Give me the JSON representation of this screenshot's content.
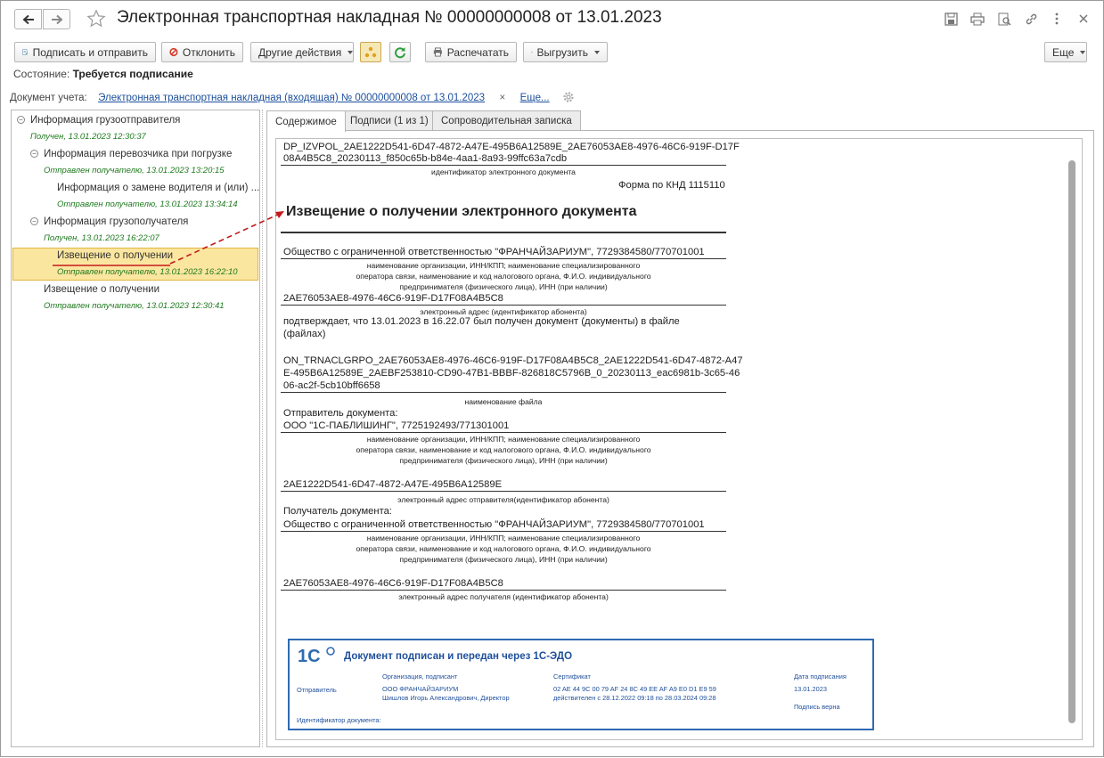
{
  "window": {
    "title": "Электронная транспортная накладная № 00000000008 от 13.01.2023",
    "icons": [
      "save-icon",
      "print-icon",
      "preview-icon",
      "link-icon",
      "more-icon",
      "close-icon"
    ]
  },
  "toolbar": {
    "sign_send": "Подписать и отправить",
    "reject": "Отклонить",
    "other_actions": "Другие действия",
    "print": "Распечатать",
    "export": "Выгрузить",
    "more": "Еще"
  },
  "state": {
    "label": "Состояние:",
    "value": "Требуется подписание"
  },
  "doc_account": {
    "label": "Документ учета:",
    "link": "Электронная транспортная накладная (входящая) № 00000000008 от 13.01.2023",
    "clear": "×",
    "more": "Еще..."
  },
  "tree": [
    {
      "title": "Информация грузоотправителя",
      "status": "Получен, 13.01.2023 12:30:37"
    },
    {
      "title": "Информация перевозчика при погрузке",
      "status": "Отправлен получателю, 13.01.2023 13:20:15"
    },
    {
      "title": "Информация о замене водителя и (или) ...",
      "status": "Отправлен получателю, 13.01.2023 13:34:14"
    },
    {
      "title": "Информация грузополучателя",
      "status": "Получен, 13.01.2023 16:22:07"
    },
    {
      "title": "Извещение о получении",
      "status": "Отправлен получателю, 13.01.2023 16:22:10"
    },
    {
      "title": "Извещение о получении",
      "status": "Отправлен получателю, 13.01.2023 12:30:41"
    }
  ],
  "tabs": [
    "Содержимое",
    "Подписи (1 из 1)",
    "Сопроводительная записка"
  ],
  "doc": {
    "id_line1": "DP_IZVPOL_2AE1222D541-6D47-4872-A47E-495B6A12589E_2AE76053AE8-4976-46C6-919F-D17F",
    "id_line2": "08A4B5C8_20230113_f850c65b-b84e-4aa1-8a93-99ffc63a7cdb",
    "id_caption": "идентификатор электронного документа",
    "form": "Форма по КНД 1115110",
    "heading": "Извещение о получении электронного документа",
    "org1": "Общество с ограниченной ответственностью \"ФРАНЧАЙЗАРИУМ\", 7729384580/770701001",
    "cap_org_1": "наименование организации, ИНН/КПП; наименование специализированного",
    "cap_org_2": "оператора связи, наименование и код налогового органа, Ф.И.О. индивидуального",
    "cap_org_3": "предпринимателя (физического лица), ИНН (при наличии)",
    "addr1": "2AE76053AE8-4976-46C6-919F-D17F08A4B5C8",
    "cap_addr1": "электронный адрес (идентификатор абонента)",
    "confirm1": "подтверждает, что 13.01.2023 в 16.22.07 был получен документ (документы) в файле",
    "confirm2": "(файлах)",
    "file1": "ON_TRNACLGRPO_2AE76053AE8-4976-46C6-919F-D17F08A4B5C8_2AE1222D541-6D47-4872-A47",
    "file2": "E-495B6A12589E_2AEBF253810-CD90-47B1-BBBF-826818C5796B_0_20230113_eac6981b-3c65-46",
    "file3": "06-ac2f-5cb10bff6658",
    "cap_file": "наименование файла",
    "sender_label": "Отправитель документа:",
    "sender": "ООО \"1С-ПАБЛИШИНГ\", 7725192493/771301001",
    "addr_sender": "2AE1222D541-6D47-4872-A47E-495B6A12589E",
    "cap_addr_sender": "электронный адрес отправителя(идентификатор абонента)",
    "recipient_label": "Получатель документа:",
    "recipient": "Общество с ограниченной ответственностью \"ФРАНЧАЙЗАРИУМ\", 7729384580/770701001",
    "addr_recipient": "2AE76053AE8-4976-46C6-919F-D17F08A4B5C8",
    "cap_addr_recipient": "электронный адрес получателя (идентификатор абонента)"
  },
  "stamp": {
    "logo": "1С",
    "title": "Документ подписан и передан через 1С-ЭДО",
    "col_org": "Организация, подписант",
    "col_cert": "Сертификат",
    "col_date": "Дата подписания",
    "role": "Отправитель",
    "org": "ООО ФРАНЧАЙЗАРИУМ",
    "signer": "Шишлов Игорь Александрович, Директор",
    "cert": "02 AE 44 9C 00 79 AF 24 8C 49 EE AF A9 E0 D1 E9 59",
    "valid": "действителен с 28.12.2022 09:18 по 28.03.2024 09:28",
    "date": "13.01.2023",
    "sig_ok": "Подпись верна",
    "doc_id": "Идентификатор документа:"
  }
}
